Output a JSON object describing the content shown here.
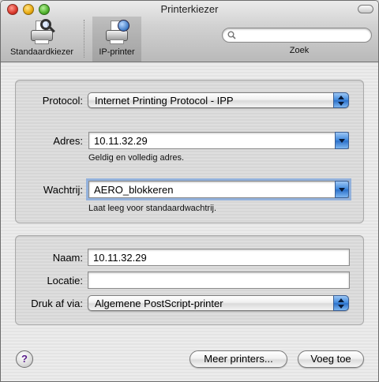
{
  "window": {
    "title": "Printerkiezer"
  },
  "toolbar": {
    "items": [
      {
        "label": "Standaardkiezer",
        "icon": "printer-browser-icon"
      },
      {
        "label": "IP-printer",
        "icon": "ip-printer-icon",
        "selected": true
      }
    ],
    "search": {
      "label": "Zoek",
      "value": "",
      "placeholder": ""
    }
  },
  "connection": {
    "protocol_label": "Protocol:",
    "protocol_value": "Internet Printing Protocol - IPP",
    "address_label": "Adres:",
    "address_value": "10.11.32.29",
    "address_hint": "Geldig en volledig adres.",
    "queue_label": "Wachtrij:",
    "queue_value": "AERO_blokkeren",
    "queue_hint": "Laat leeg voor standaardwachtrij."
  },
  "details": {
    "name_label": "Naam:",
    "name_value": "10.11.32.29",
    "location_label": "Locatie:",
    "location_value": "",
    "driver_label": "Druk af via:",
    "driver_value": "Algemene PostScript-printer"
  },
  "footer": {
    "help_label": "?",
    "more_printers_label": "Meer printers...",
    "add_label": "Voeg toe"
  },
  "colors": {
    "accent": "#3d87dd",
    "window_bg": "#ececec"
  }
}
